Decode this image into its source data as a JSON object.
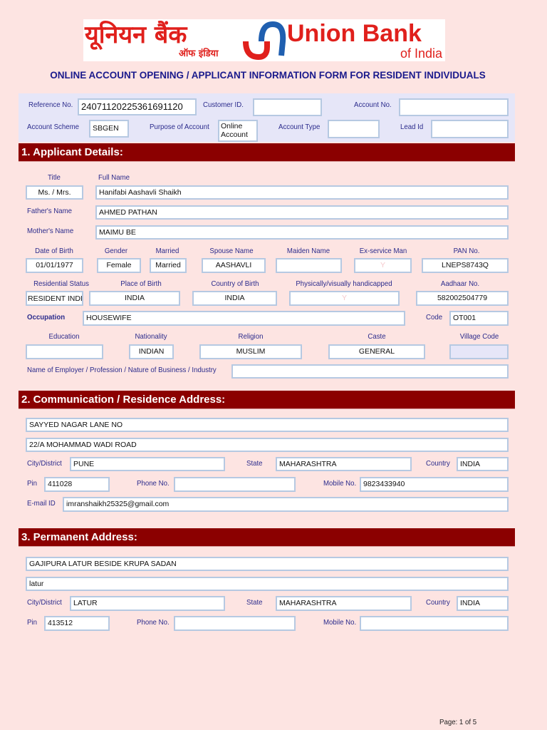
{
  "logo": {
    "hindi": "यूनियन बैंक",
    "hindi_sub": "ऑफ इंडिया",
    "english": "Union Bank",
    "english_sub": "of India"
  },
  "form_title": "ONLINE ACCOUNT OPENING / APPLICANT INFORMATION FORM FOR RESIDENT INDIVIDUALS",
  "header": {
    "reference_label": "Reference No.",
    "reference_value": "24071120225361691120",
    "customer_id_label": "Customer ID.",
    "customer_id_value": "",
    "account_no_label": "Account No.",
    "account_no_value": "",
    "scheme_label": "Account Scheme",
    "scheme_value": "SBGEN",
    "purpose_label": "Purpose of Account",
    "purpose_value": "Online Account",
    "type_label": "Account Type",
    "type_value": "",
    "lead_label": "Lead Id",
    "lead_value": ""
  },
  "applicant": {
    "heading": "1. Applicant Details:",
    "title_label": "Title",
    "title_value": "Ms. / Mrs.",
    "full_name_label": "Full Name",
    "full_name_value": "Hanifabi Aashavli Shaikh",
    "father_label": "Father's Name",
    "father_value": "AHMED PATHAN",
    "mother_label": "Mother's Name",
    "mother_value": "MAIMU BE",
    "dob_label": "Date of Birth",
    "dob_value": "01/01/1977",
    "gender_label": "Gender",
    "gender_value": "Female",
    "married_label": "Married",
    "married_value": "Married",
    "spouse_label": "Spouse Name",
    "spouse_value": "AASHAVLI",
    "maiden_label": "Maiden Name",
    "maiden_value": "",
    "exservice_label": "Ex-service Man",
    "exservice_value": "Y",
    "pan_label": "PAN No.",
    "pan_value": "LNEPS8743Q",
    "residential_label": "Residential Status",
    "residential_value": "RESIDENT INDIAN",
    "pob_label": "Place of Birth",
    "pob_value": "INDIA",
    "cob_label": "Country of Birth",
    "cob_value": "INDIA",
    "handicap_label": "Physically/visually handicapped",
    "handicap_value": "Y",
    "aadhaar_label": "Aadhaar No.",
    "aadhaar_value": "582002504779",
    "occupation_label": "Occupation",
    "occupation_value": "HOUSEWIFE",
    "code_label": "Code",
    "code_value": "OT001",
    "education_label": "Education",
    "education_value": "",
    "nationality_label": "Nationality",
    "nationality_value": "INDIAN",
    "religion_label": "Religion",
    "religion_value": "MUSLIM",
    "caste_label": "Caste",
    "caste_value": "GENERAL",
    "village_label": "Village Code",
    "village_value": "",
    "employer_label": "Name of Employer / Profession / Nature of Business / Industry",
    "employer_value": ""
  },
  "communication": {
    "heading": "2. Communication / Residence Address:",
    "line1": "SAYYED NAGAR LANE NO",
    "line2": "22/A MOHAMMAD WADI ROAD",
    "city_label": "City/District",
    "city_value": "PUNE",
    "state_label": "State",
    "state_value": "MAHARASHTRA",
    "country_label": "Country",
    "country_value": "INDIA",
    "pin_label": "Pin",
    "pin_value": "411028",
    "phone_label": "Phone No.",
    "phone_value": "",
    "mobile_label": "Mobile No.",
    "mobile_value": "9823433940",
    "email_label": "E-mail ID",
    "email_value": "imranshaikh25325@gmail.com"
  },
  "permanent": {
    "heading": "3. Permanent Address:",
    "line1": "GAJIPURA LATUR BESIDE KRUPA SADAN",
    "line2": "latur",
    "city_label": "City/District",
    "city_value": "LATUR",
    "state_label": "State",
    "state_value": "MAHARASHTRA",
    "country_label": "Country",
    "country_value": "INDIA",
    "pin_label": "Pin",
    "pin_value": "413512",
    "phone_label": "Phone No.",
    "phone_value": "",
    "mobile_label": "Mobile No.",
    "mobile_value": ""
  },
  "footer": {
    "page": "Page: 1 of 5"
  }
}
